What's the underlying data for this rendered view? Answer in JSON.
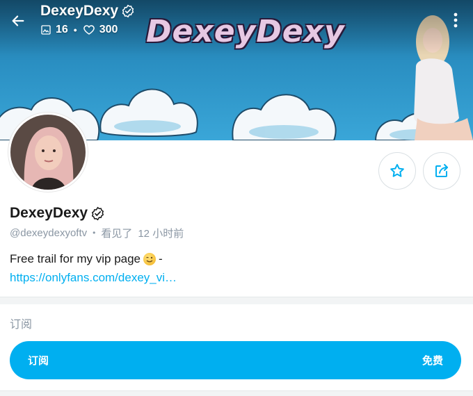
{
  "header": {
    "title": "DexeyDexy",
    "media_count": "16",
    "likes_count": "300",
    "banner_wordmark": "DexeyDexy"
  },
  "profile": {
    "name": "DexeyDexy",
    "handle": "@dexeydexyoftv",
    "seen_label": "看见了",
    "seen_time": "12 小时前",
    "bio_text": "Free trail for my vip page",
    "bio_suffix": "-",
    "bio_link": "https://onlyfans.com/dexey_vi…"
  },
  "subscription": {
    "section_title": "订阅",
    "button_label": "订阅",
    "price_label": "免费"
  },
  "colors": {
    "accent": "#00aff0",
    "muted_text": "#8a96a3",
    "banner_sky": "#2a8fc2"
  },
  "icons": {
    "back": "arrow-left-icon",
    "verified": "verified-badge-icon",
    "media": "image-icon",
    "likes": "heart-icon",
    "more": "more-vertical-icon",
    "favorite": "star-icon",
    "share": "share-icon"
  }
}
